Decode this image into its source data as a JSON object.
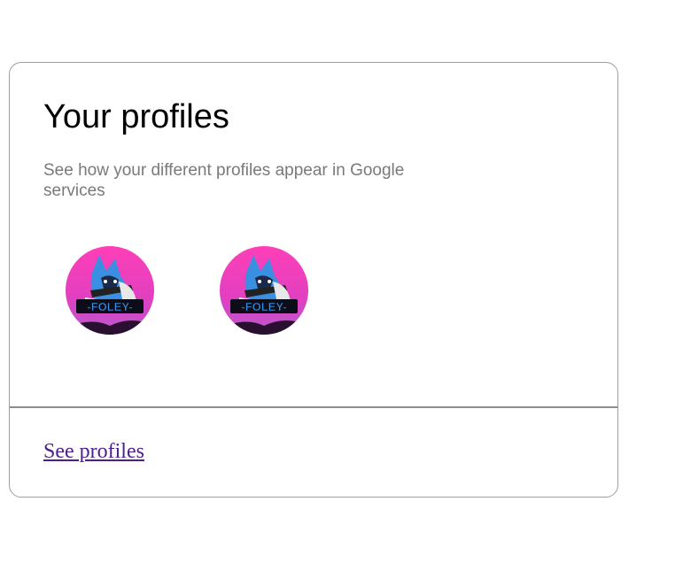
{
  "card": {
    "title": "Your profiles",
    "subtitle": "See how your different profiles appear in Google services",
    "profiles": [
      {
        "avatar_text": "-FOLEY-",
        "icon": "wolf-gamer-avatar-icon"
      },
      {
        "avatar_text": "-FOLEY-",
        "icon": "wolf-gamer-avatar-icon"
      }
    ],
    "see_profiles_label": "See profiles"
  },
  "colors": {
    "link": "#4b1f8f",
    "subtitle": "#7a7a7a",
    "border": "#9e9e9e",
    "avatar_bg_top": "#ff3fb8",
    "avatar_bg_bottom": "#c850c8",
    "avatar_banner": "#1e6fd8"
  }
}
